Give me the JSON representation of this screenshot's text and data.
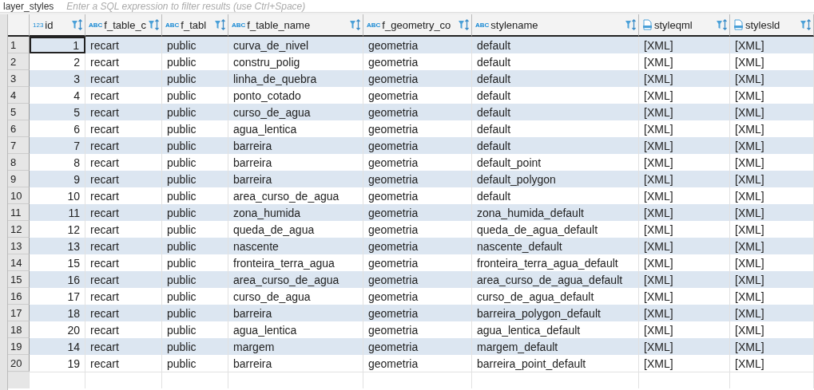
{
  "top_bar": {
    "tab_title": "layer_styles",
    "filter_placeholder": "Enter a SQL expression to filter results (use Ctrl+Space)"
  },
  "table": {
    "columns": [
      {
        "kind": "number",
        "type_label": "123",
        "name": "id"
      },
      {
        "kind": "text",
        "type_label": "ABC",
        "name": "f_table_c"
      },
      {
        "kind": "text",
        "type_label": "ABC",
        "name": "f_tabl"
      },
      {
        "kind": "text",
        "type_label": "ABC",
        "name": "f_table_name"
      },
      {
        "kind": "text",
        "type_label": "ABC",
        "name": "f_geometry_co"
      },
      {
        "kind": "text",
        "type_label": "ABC",
        "name": "stylename"
      },
      {
        "kind": "xml",
        "name": "styleqml"
      },
      {
        "kind": "xml",
        "name": "stylesld"
      }
    ],
    "rows": [
      {
        "number": "1",
        "selected": true,
        "cells": [
          "1",
          "recart",
          "public",
          "curva_de_nivel",
          "geometria",
          "default",
          "[XML]",
          "[XML]"
        ]
      },
      {
        "number": "2",
        "selected": false,
        "cells": [
          "2",
          "recart",
          "public",
          "constru_polig",
          "geometria",
          "default",
          "[XML]",
          "[XML]"
        ]
      },
      {
        "number": "3",
        "selected": false,
        "cells": [
          "3",
          "recart",
          "public",
          "linha_de_quebra",
          "geometria",
          "default",
          "[XML]",
          "[XML]"
        ]
      },
      {
        "number": "4",
        "selected": false,
        "cells": [
          "4",
          "recart",
          "public",
          "ponto_cotado",
          "geometria",
          "default",
          "[XML]",
          "[XML]"
        ]
      },
      {
        "number": "5",
        "selected": false,
        "cells": [
          "5",
          "recart",
          "public",
          "curso_de_agua",
          "geometria",
          "default",
          "[XML]",
          "[XML]"
        ]
      },
      {
        "number": "6",
        "selected": false,
        "cells": [
          "6",
          "recart",
          "public",
          "agua_lentica",
          "geometria",
          "default",
          "[XML]",
          "[XML]"
        ]
      },
      {
        "number": "7",
        "selected": false,
        "cells": [
          "7",
          "recart",
          "public",
          "barreira",
          "geometria",
          "default",
          "[XML]",
          "[XML]"
        ]
      },
      {
        "number": "8",
        "selected": false,
        "cells": [
          "8",
          "recart",
          "public",
          "barreira",
          "geometria",
          "default_point",
          "[XML]",
          "[XML]"
        ]
      },
      {
        "number": "9",
        "selected": false,
        "cells": [
          "9",
          "recart",
          "public",
          "barreira",
          "geometria",
          "default_polygon",
          "[XML]",
          "[XML]"
        ]
      },
      {
        "number": "10",
        "selected": false,
        "cells": [
          "10",
          "recart",
          "public",
          "area_curso_de_agua",
          "geometria",
          "default",
          "[XML]",
          "[XML]"
        ]
      },
      {
        "number": "11",
        "selected": false,
        "cells": [
          "11",
          "recart",
          "public",
          "zona_humida",
          "geometria",
          "zona_humida_default",
          "[XML]",
          "[XML]"
        ]
      },
      {
        "number": "12",
        "selected": false,
        "cells": [
          "12",
          "recart",
          "public",
          "queda_de_agua",
          "geometria",
          "queda_de_agua_default",
          "[XML]",
          "[XML]"
        ]
      },
      {
        "number": "13",
        "selected": false,
        "cells": [
          "13",
          "recart",
          "public",
          "nascente",
          "geometria",
          "nascente_default",
          "[XML]",
          "[XML]"
        ]
      },
      {
        "number": "14",
        "selected": false,
        "cells": [
          "15",
          "recart",
          "public",
          "fronteira_terra_agua",
          "geometria",
          "fronteira_terra_agua_default",
          "[XML]",
          "[XML]"
        ]
      },
      {
        "number": "15",
        "selected": false,
        "cells": [
          "16",
          "recart",
          "public",
          "area_curso_de_agua",
          "geometria",
          "area_curso_de_agua_default",
          "[XML]",
          "[XML]"
        ]
      },
      {
        "number": "16",
        "selected": false,
        "cells": [
          "17",
          "recart",
          "public",
          "curso_de_agua",
          "geometria",
          "curso_de_agua_default",
          "[XML]",
          "[XML]"
        ]
      },
      {
        "number": "17",
        "selected": false,
        "cells": [
          "18",
          "recart",
          "public",
          "barreira",
          "geometria",
          "barreira_polygon_default",
          "[XML]",
          "[XML]"
        ]
      },
      {
        "number": "18",
        "selected": false,
        "cells": [
          "20",
          "recart",
          "public",
          "agua_lentica",
          "geometria",
          "agua_lentica_default",
          "[XML]",
          "[XML]"
        ]
      },
      {
        "number": "19",
        "selected": false,
        "cells": [
          "14",
          "recart",
          "public",
          "margem",
          "geometria",
          "margem_default",
          "[XML]",
          "[XML]"
        ]
      },
      {
        "number": "20",
        "selected": false,
        "cells": [
          "19",
          "recart",
          "public",
          "barreira",
          "geometria",
          "barreira_point_default",
          "[XML]",
          "[XML]"
        ]
      }
    ]
  }
}
